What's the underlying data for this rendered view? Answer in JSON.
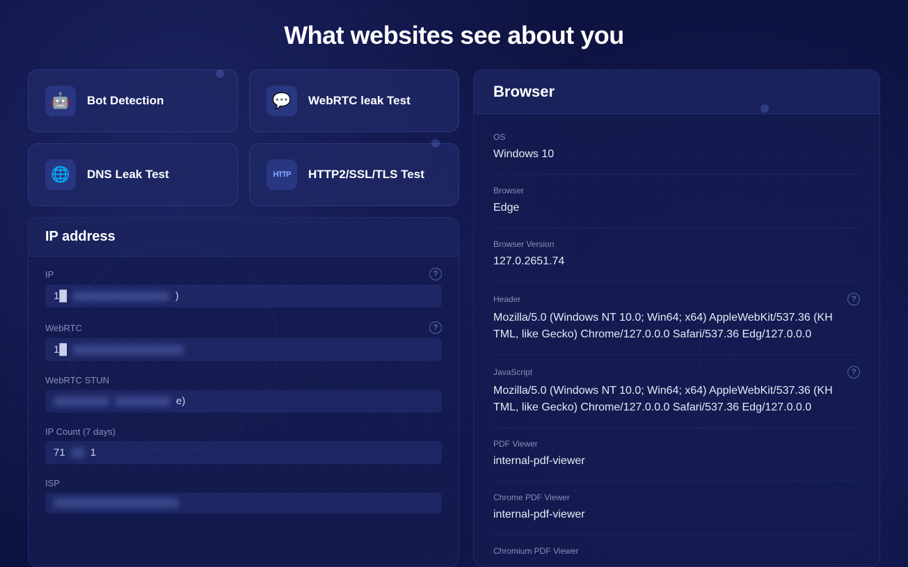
{
  "page": {
    "title": "What websites see about you"
  },
  "nav": {
    "buttons": [
      {
        "id": "bot-detection",
        "label": "Bot Detection",
        "icon": "🤖"
      },
      {
        "id": "webrtc-leak",
        "label": "WebRTC leak Test",
        "icon": "💬"
      },
      {
        "id": "dns-leak",
        "label": "DNS Leak Test",
        "icon": "🌐"
      },
      {
        "id": "http2-ssl",
        "label": "HTTP2/SSL/TLS Test",
        "icon": "HTTP"
      }
    ]
  },
  "ip_address": {
    "title": "IP address",
    "fields": [
      {
        "label": "IP",
        "value_prefix": "1█",
        "value_blur": "████████████",
        "value_suffix": ")",
        "has_help": true
      },
      {
        "label": "WebRTC",
        "value_prefix": "1█",
        "value_blur": "█████████████████",
        "value_suffix": "",
        "has_help": true
      },
      {
        "label": "WebRTC STUN",
        "value_prefix": "",
        "value_blur": "████████   ██████",
        "value_suffix": "e)",
        "has_help": false
      },
      {
        "label": "IP Count (7 days)",
        "value_prefix": "71",
        "value_blur": "██",
        "value_suffix": "1",
        "has_help": false
      },
      {
        "label": "ISP",
        "value_prefix": "",
        "value_blur": "████████████████",
        "value_suffix": "",
        "has_help": false
      }
    ]
  },
  "browser": {
    "title": "Browser",
    "fields": [
      {
        "label": "OS",
        "value": "Windows 10",
        "has_help": false
      },
      {
        "label": "Browser",
        "value": "Edge",
        "has_help": false
      },
      {
        "label": "Browser Version",
        "value": "127.0.2651.74",
        "has_help": false
      },
      {
        "label": "Header",
        "value": "Mozilla/5.0 (Windows NT 10.0; Win64; x64) AppleWebKit/537.36 (KH TML, like Gecko) Chrome/127.0.0.0 Safari/537.36 Edg/127.0.0.0",
        "has_help": true
      },
      {
        "label": "JavaScript",
        "value": "Mozilla/5.0 (Windows NT 10.0; Win64; x64) AppleWebKit/537.36 (KH TML, like Gecko) Chrome/127.0.0.0 Safari/537.36 Edg/127.0.0.0",
        "has_help": true
      },
      {
        "label": "PDF Viewer",
        "value": "internal-pdf-viewer",
        "has_help": false
      },
      {
        "label": "Chrome PDF Viewer",
        "value": "internal-pdf-viewer",
        "has_help": false
      },
      {
        "label": "Chromium PDF Viewer",
        "value": "",
        "has_help": false
      }
    ]
  }
}
